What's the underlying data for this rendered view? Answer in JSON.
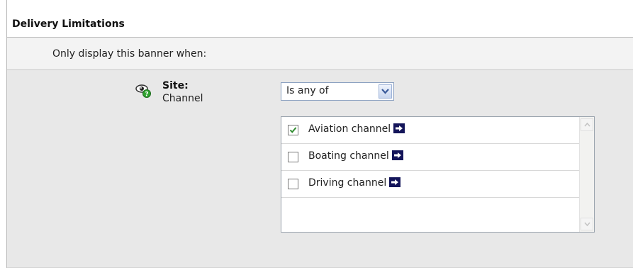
{
  "section": {
    "title": "Delivery Limitations",
    "instruction": "Only display this banner when:"
  },
  "limitation": {
    "icon": "eye-icon",
    "group_label": "Site:",
    "type_label": "Channel",
    "operator": {
      "selected": "Is any of"
    },
    "channels": [
      {
        "label": "Aviation channel",
        "checked": true
      },
      {
        "label": "Boating channel",
        "checked": false
      },
      {
        "label": "Driving channel",
        "checked": false
      }
    ]
  },
  "colors": {
    "go_icon": "#14155a",
    "check_mark": "#2e8b2e",
    "eye_badge": "#2fa32f"
  }
}
